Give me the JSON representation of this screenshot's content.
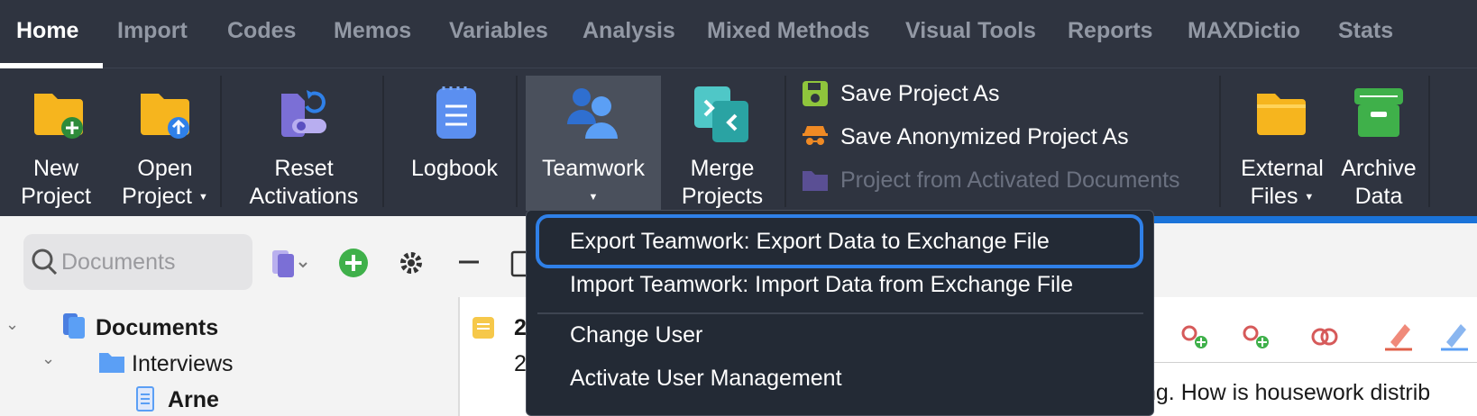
{
  "menu_tabs": [
    {
      "label": "Home",
      "active": true
    },
    {
      "label": "Import"
    },
    {
      "label": "Codes"
    },
    {
      "label": "Memos"
    },
    {
      "label": "Variables"
    },
    {
      "label": "Analysis"
    },
    {
      "label": "Mixed Methods"
    },
    {
      "label": "Visual Tools"
    },
    {
      "label": "Reports"
    },
    {
      "label": "MAXDictio"
    },
    {
      "label": "Stats"
    }
  ],
  "ribbon": {
    "new_project": {
      "line1": "New",
      "line2": "Project"
    },
    "open_project": {
      "line1": "Open",
      "line2": "Project"
    },
    "reset_activations": {
      "line1": "Reset",
      "line2": "Activations"
    },
    "logbook": {
      "line1": "Logbook"
    },
    "teamwork": {
      "line1": "Teamwork"
    },
    "merge_projects": {
      "line1": "Merge",
      "line2": "Projects"
    },
    "save_project_as": "Save Project As",
    "save_anonymized": "Save Anonymized Project As",
    "project_from_activated": "Project from Activated Documents",
    "external_files": {
      "line1": "External",
      "line2": "Files"
    },
    "archive_data": {
      "line1": "Archive",
      "line2": "Data"
    }
  },
  "document_browser": {
    "search_placeholder": "Documents",
    "tree": {
      "root": "Documents",
      "folder": "Interviews",
      "doc": "Arne"
    }
  },
  "document_viewer": {
    "number_top": "2",
    "number_bottom": "2",
    "text": "ng. How is housework distrib"
  },
  "teamwork_menu": {
    "items": [
      "Export Teamwork: Export Data to Exchange File",
      "Import Teamwork: Import Data from Exchange File",
      "Change User",
      "Activate User Management"
    ]
  },
  "colors": {
    "chrome": "#2f3440",
    "accent_blue": "#2f80e8",
    "folder_yellow": "#f6b51e"
  }
}
